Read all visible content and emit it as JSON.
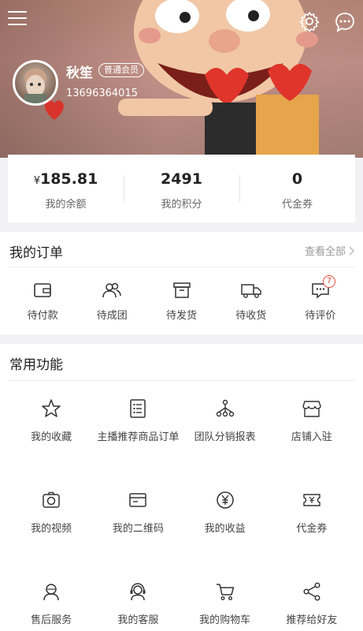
{
  "header": {
    "user_name": "秋笙",
    "member_badge": "普通会员",
    "phone": "13696364015",
    "colors": {
      "accent_red": "#e24c3f"
    }
  },
  "balance": [
    {
      "currency": "¥",
      "value": "185.81",
      "label": "我的余额"
    },
    {
      "currency": "",
      "value": "2491",
      "label": "我的积分"
    },
    {
      "currency": "",
      "value": "0",
      "label": "代金券"
    }
  ],
  "orders": {
    "title": "我的订单",
    "view_all": "查看全部",
    "items": [
      {
        "label": "待付款",
        "icon": "wallet-icon"
      },
      {
        "label": "待成团",
        "icon": "group-icon"
      },
      {
        "label": "待发货",
        "icon": "box-icon"
      },
      {
        "label": "待收货",
        "icon": "truck-icon"
      },
      {
        "label": "待评价",
        "icon": "comment-icon",
        "badge": "7"
      }
    ]
  },
  "functions": {
    "title": "常用功能",
    "items": [
      {
        "label": "我的收藏",
        "icon": "star-icon"
      },
      {
        "label": "主播推荐商品订单",
        "icon": "list-icon"
      },
      {
        "label": "团队分销报表",
        "icon": "network-icon"
      },
      {
        "label": "店铺入驻",
        "icon": "store-icon"
      },
      {
        "label": "我的视频",
        "icon": "camera-icon"
      },
      {
        "label": "我的二维码",
        "icon": "card-icon"
      },
      {
        "label": "我的收益",
        "icon": "yen-icon"
      },
      {
        "label": "代金券",
        "icon": "ticket-icon"
      },
      {
        "label": "售后服务",
        "icon": "service-icon"
      },
      {
        "label": "我的客服",
        "icon": "headset-icon"
      },
      {
        "label": "我的购物车",
        "icon": "cart-icon"
      },
      {
        "label": "推荐给好友",
        "icon": "share-icon"
      }
    ]
  }
}
